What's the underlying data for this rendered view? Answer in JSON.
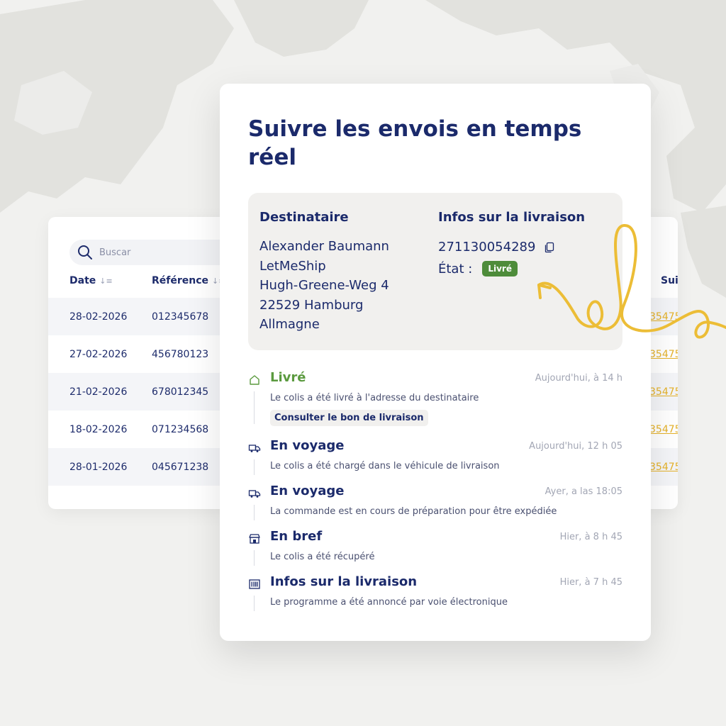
{
  "background_table": {
    "search_placeholder": "Buscar",
    "columns": {
      "date": "Date",
      "reference": "Référence",
      "tracking": "Suiv"
    },
    "rows": [
      {
        "date": "28-02-2026",
        "reference": "012345678",
        "tracking": "35475"
      },
      {
        "date": "27-02-2026",
        "reference": "456780123",
        "tracking": "35475"
      },
      {
        "date": "21-02-2026",
        "reference": "678012345",
        "tracking": "35475"
      },
      {
        "date": "18-02-2026",
        "reference": "071234568",
        "tracking": "35475"
      },
      {
        "date": "28-01-2026",
        "reference": "045671238",
        "tracking": "35475"
      }
    ]
  },
  "main": {
    "title": "Suivre les envois en temps réel",
    "recipient": {
      "heading": "Destinataire",
      "lines": [
        "Alexander Baumann",
        "LetMeShip",
        "Hugh-Greene-Weg 4",
        "22529 Hamburg",
        "Allmagne"
      ]
    },
    "delivery": {
      "heading": "Infos sur la livraison",
      "tracking_number": "271130054289",
      "state_label": "État :",
      "state_badge": "Livré"
    },
    "events": [
      {
        "icon": "house-icon",
        "title": "Livré",
        "time": "Aujourd'hui, à 14 h",
        "desc": "Le colis a été livré à l'adresse du destinataire",
        "button": "Consulter le bon de livraison"
      },
      {
        "icon": "truck-icon",
        "title": "En voyage",
        "time": "Aujourd'hui, 12 h 05",
        "desc": "Le colis a été chargé dans le véhicule de livraison"
      },
      {
        "icon": "truck-icon",
        "title": "En voyage",
        "time": "Ayer, a las 18:05",
        "desc": "La commande est en cours de préparation pour être expédiée"
      },
      {
        "icon": "store-icon",
        "title": "En bref",
        "time": "Hier, à 8 h 45",
        "desc": "Le colis a été récupéré"
      },
      {
        "icon": "barcode-icon",
        "title": "Infos sur la livraison",
        "time": "Hier, à 7 h 45",
        "desc": "Le programme a été annoncé par voie électronique"
      }
    ]
  },
  "colors": {
    "navy": "#1b2a6b",
    "green": "#5b9a3f",
    "badge_green": "#4e8c3a",
    "accent_yellow": "#e5b22a"
  }
}
